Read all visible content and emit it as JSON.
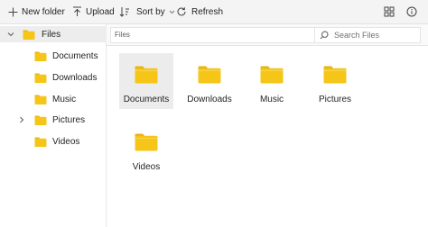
{
  "toolbar": {
    "new_folder_label": "New folder",
    "upload_label": "Upload",
    "sort_label": "Sort by",
    "refresh_label": "Refresh",
    "view_icon": "grid-view-icon",
    "info_icon": "info-icon"
  },
  "colors": {
    "folder": "#F5C518",
    "folder_tab": "#E9B10C",
    "selection": "#ECECEC"
  },
  "sidebar": {
    "items": [
      {
        "label": "Files",
        "expanded": true
      },
      {
        "label": "Documents"
      },
      {
        "label": "Downloads"
      },
      {
        "label": "Music"
      },
      {
        "label": "Pictures",
        "collapsed": true
      },
      {
        "label": "Videos"
      }
    ]
  },
  "address": {
    "path": "Files",
    "search_placeholder": "Search Files"
  },
  "main": {
    "items": [
      {
        "label": "Documents",
        "selected": true
      },
      {
        "label": "Downloads"
      },
      {
        "label": "Music"
      },
      {
        "label": "Pictures"
      },
      {
        "label": "Videos"
      }
    ]
  }
}
